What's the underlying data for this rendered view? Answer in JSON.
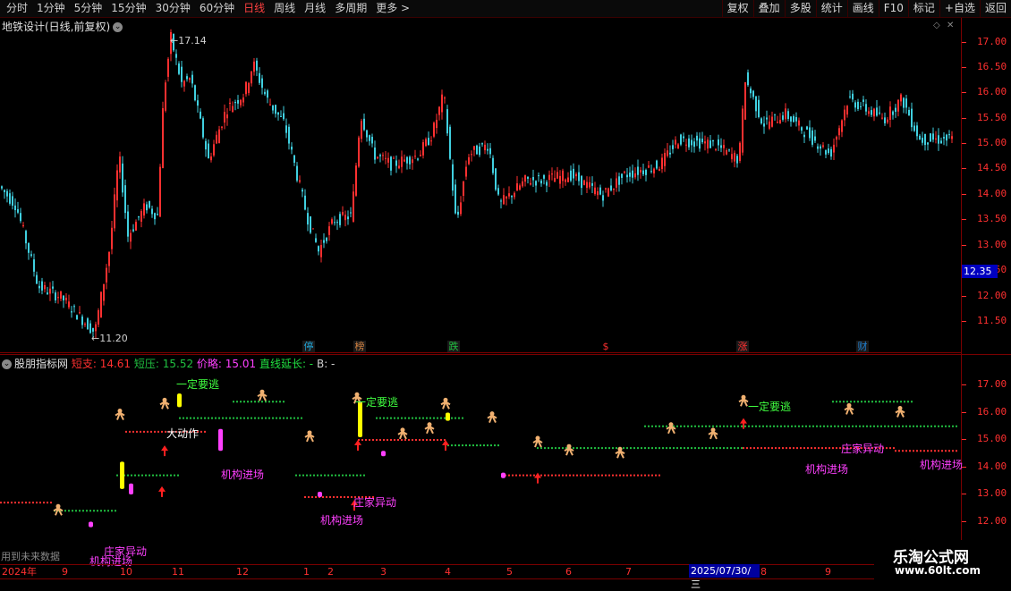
{
  "toolbar": {
    "periods": [
      "分时",
      "1分钟",
      "5分钟",
      "15分钟",
      "30分钟",
      "60分钟",
      "日线",
      "周线",
      "月线",
      "多周期",
      "更多 >"
    ],
    "active_period": "日线",
    "right": [
      "复权",
      "叠加",
      "多股",
      "统计",
      "画线",
      "F10",
      "标记",
      "+自选",
      "返回"
    ]
  },
  "main": {
    "title": "地铁设计(日线,前复权)",
    "title_chevron": "chevron-down-icon",
    "high_label": "17.14",
    "low_label": "11.20",
    "current_price": "12.35",
    "y_ticks": [
      "17.00",
      "16.50",
      "16.00",
      "15.50",
      "15.00",
      "14.50",
      "14.00",
      "13.50",
      "13.00",
      "12.50",
      "12.00",
      "11.50"
    ],
    "events": [
      {
        "label": "停",
        "color": "#20a0d0"
      },
      {
        "label": "榜",
        "color": "#d08040"
      },
      {
        "label": "跌",
        "color": "#20c040"
      },
      {
        "label": "$",
        "color": "#ff3030"
      },
      {
        "label": "涨",
        "color": "#ff3030"
      },
      {
        "label": "财",
        "color": "#2080d0"
      }
    ]
  },
  "indicator": {
    "name": "股朋指标网",
    "values": [
      {
        "label": "短支: 14.61",
        "color": "#ff3030"
      },
      {
        "label": "短压: 15.52",
        "color": "#20c040"
      },
      {
        "label": "价略: 15.01",
        "color": "#ff40ff"
      },
      {
        "label": "直线延长: -",
        "color": "#20e040"
      },
      {
        "label": "B: -",
        "color": "#d0d0d0"
      }
    ],
    "y_ticks": [
      "17.00",
      "16.00",
      "15.00",
      "14.00",
      "13.00",
      "12.00"
    ],
    "annotations": [
      {
        "text": "一定要逃",
        "color": "#40ff40"
      },
      {
        "text": "大动作",
        "color": "#ffffff"
      },
      {
        "text": "机构进场",
        "color": "#ff40ff"
      },
      {
        "text": "一定要逃",
        "color": "#40ff40"
      },
      {
        "text": "庄家异动",
        "color": "#ff40ff"
      },
      {
        "text": "机构进场",
        "color": "#ff40ff"
      },
      {
        "text": "一定要逃",
        "color": "#40ff40"
      },
      {
        "text": "庄家异动",
        "color": "#ff40ff"
      },
      {
        "text": "机构进场",
        "color": "#ff40ff"
      },
      {
        "text": "机构进场",
        "color": "#ff40ff"
      },
      {
        "text": "庄家异动",
        "color": "#ff40ff"
      },
      {
        "text": "机构进场",
        "color": "#ff40ff"
      }
    ],
    "future_note": "用到未来数据"
  },
  "date_axis": {
    "labels": [
      "2024年",
      "9",
      "10",
      "11",
      "12",
      "1",
      "2",
      "3",
      "4",
      "5",
      "6",
      "7",
      "8",
      "9",
      "10"
    ],
    "cursor_date": "2025/07/30/三"
  },
  "watermark": {
    "line1": "乐淘公式网",
    "line2": "www.60lt.com"
  },
  "colors": {
    "up": "#ff3030",
    "down": "#40d0e0",
    "bg": "#000000"
  }
}
